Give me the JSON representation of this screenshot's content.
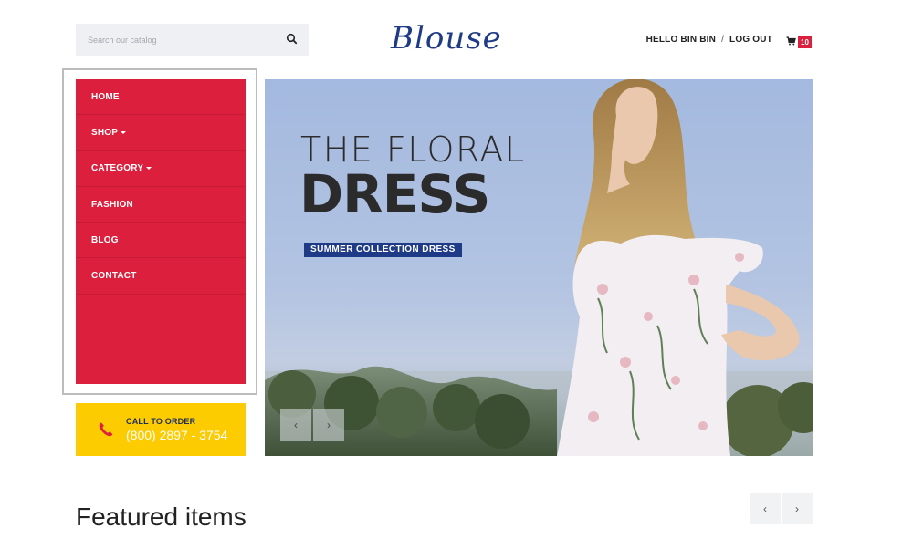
{
  "header": {
    "search_placeholder": "Search our catalog",
    "logo": "Blouse",
    "greeting": "HELLO BIN BIN",
    "separator": "/",
    "logout": "LOG OUT",
    "cart_count": "10"
  },
  "menu": {
    "items": [
      {
        "label": "HOME"
      },
      {
        "label": "SHOP"
      },
      {
        "label": "CATEGORY"
      },
      {
        "label": "FASHION"
      },
      {
        "label": "BLOG"
      },
      {
        "label": "CONTACT"
      }
    ]
  },
  "call": {
    "label": "CALL TO ORDER",
    "number": "(800) 2897 - 3754"
  },
  "slider": {
    "title_line1": "THE FLORAL",
    "title_line2": "DRESS",
    "tag": "SUMMER COLLECTION DRESS",
    "prev": "‹",
    "next": "›"
  },
  "featured": {
    "title": "Featured items",
    "prev": "‹",
    "next": "›"
  },
  "colors": {
    "brand_red": "#dc1f3c",
    "brand_blue": "#1f3a86",
    "call_yellow": "#fccb00"
  }
}
